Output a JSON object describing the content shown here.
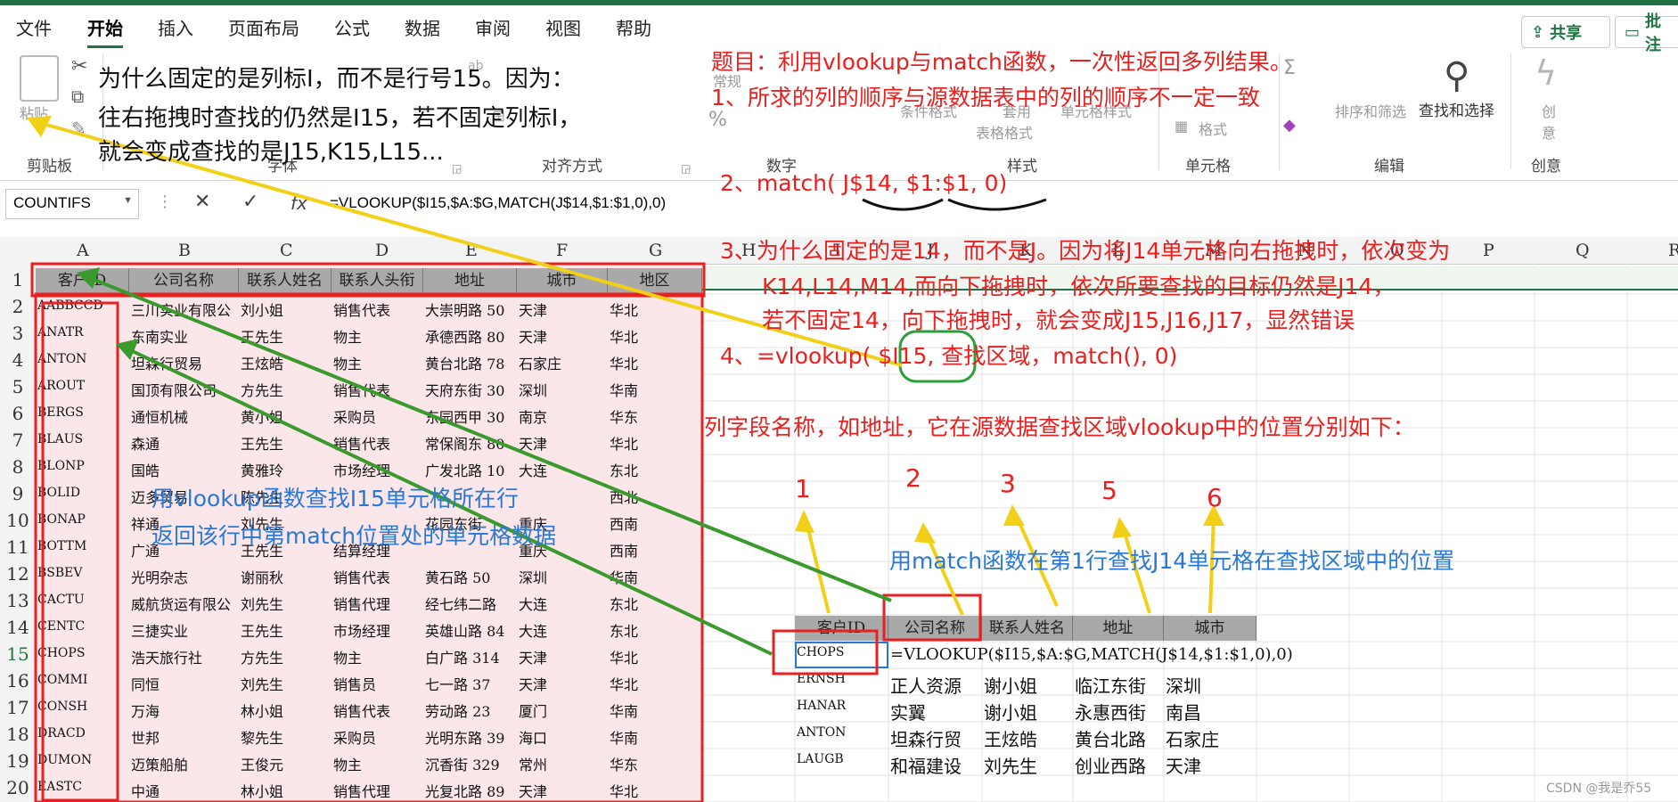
{
  "tabs": [
    "文件",
    "开始",
    "插入",
    "页面布局",
    "公式",
    "数据",
    "审阅",
    "视图",
    "帮助"
  ],
  "active_tab": "开始",
  "share_button": "共享",
  "comment_button": "批注",
  "ribbon": {
    "paste": "粘贴",
    "groups": [
      "剪贴板",
      "字体",
      "对齐方式",
      "数字",
      "样式",
      "单元格",
      "编辑",
      "创意"
    ],
    "number_format": "常规",
    "conditional": "条件格式",
    "table_format_1": "套用",
    "table_format_2": "表格格式",
    "cell_style": "单元格样式",
    "format": "格式",
    "sort": "排序和筛选",
    "find": "查找和选择",
    "creative_1": "创",
    "creative_2": "意"
  },
  "name_box": "COUNTIFS",
  "fx": "fx",
  "formula": "=VLOOKUP($I15,$A:$G,MATCH(J$14,$1:$1,0),0)",
  "columns": [
    "A",
    "B",
    "C",
    "D",
    "E",
    "F",
    "G",
    "H",
    "I",
    "J",
    "K",
    "L",
    "M",
    "N",
    "O",
    "P",
    "Q",
    "R"
  ],
  "rows": [
    "1",
    "2",
    "3",
    "4",
    "5",
    "6",
    "7",
    "8",
    "9",
    "10",
    "11",
    "12",
    "13",
    "14",
    "15",
    "16",
    "17",
    "18",
    "19",
    "20"
  ],
  "source_header": [
    "客户ID",
    "公司名称",
    "联系人姓名",
    "联系人头衔",
    "地址",
    "城市",
    "地区"
  ],
  "source_rows": [
    [
      "AABBCCD",
      "三川实业有限公",
      "刘小姐",
      "销售代表",
      "大崇明路 50",
      "天津",
      "华北"
    ],
    [
      "ANATR",
      "东南实业",
      "王先生",
      "物主",
      "承德西路 80",
      "天津",
      "华北"
    ],
    [
      "ANTON",
      "坦森行贸易",
      "王炫皓",
      "物主",
      "黄台北路 78",
      "石家庄",
      "华北"
    ],
    [
      "AROUT",
      "国顶有限公司",
      "方先生",
      "销售代表",
      "天府东街 30",
      "深圳",
      "华南"
    ],
    [
      "BERGS",
      "通恒机械",
      "黄小姐",
      "采购员",
      "东园西甲 30",
      "南京",
      "华东"
    ],
    [
      "BLAUS",
      "森通",
      "王先生",
      "销售代表",
      "常保阁东 80",
      "天津",
      "华北"
    ],
    [
      "BLONP",
      "国皓",
      "黄雅玲",
      "市场经理",
      "广发北路 10",
      "大连",
      "东北"
    ],
    [
      "BOLID",
      "迈多贸易",
      "陈先生",
      "",
      "",
      "",
      "西北"
    ],
    [
      "BONAP",
      "祥通",
      "刘先生",
      "",
      "花园东街",
      "重庆",
      "西南"
    ],
    [
      "BOTTM",
      "广通",
      "王先生",
      "结算经理",
      "",
      "重庆",
      "西南"
    ],
    [
      "BSBEV",
      "光明杂志",
      "谢丽秋",
      "销售代表",
      "黄石路 50",
      "深圳",
      "华南"
    ],
    [
      "CACTU",
      "威航货运有限公",
      "刘先生",
      "销售代理",
      "经七纬二路",
      "大连",
      "东北"
    ],
    [
      "CENTC",
      "三捷实业",
      "王先生",
      "市场经理",
      "英雄山路 84",
      "大连",
      "东北"
    ],
    [
      "CHOPS",
      "浩天旅行社",
      "方先生",
      "物主",
      "白广路 314",
      "天津",
      "华北"
    ],
    [
      "COMMI",
      "同恒",
      "刘先生",
      "销售员",
      "七一路 37",
      "天津",
      "华北"
    ],
    [
      "CONSH",
      "万海",
      "林小姐",
      "销售代表",
      "劳动路 23",
      "厦门",
      "华南"
    ],
    [
      "DRACD",
      "世邦",
      "黎先生",
      "采购员",
      "光明东路 39",
      "海口",
      "华南"
    ],
    [
      "DUMON",
      "迈策船舶",
      "王俊元",
      "物主",
      "沉香街 329",
      "常州",
      "华东"
    ],
    [
      "EASTC",
      "中通",
      "林小姐",
      "销售代理",
      "光复北路 89",
      "天津",
      "华北"
    ]
  ],
  "result_header": [
    "客户ID",
    "公司名称",
    "联系人姓名",
    "地址",
    "城市"
  ],
  "result_formula": "=VLOOKUP($I15,$A:$G,MATCH(J$14,$1:$1,0),0)",
  "result_rows": [
    [
      "CHOPS",
      "",
      "",
      "",
      ""
    ],
    [
      "ERNSH",
      "正人资源",
      "谢小姐",
      "临江东街",
      "深圳"
    ],
    [
      "HANAR",
      "实翼",
      "谢小姐",
      "永惠西街",
      "南昌"
    ],
    [
      "ANTON",
      "坦森行贸",
      "王炫皓",
      "黄台北路",
      "石家庄"
    ],
    [
      "LAUGB",
      "和福建设",
      "刘先生",
      "创业西路",
      "天津"
    ]
  ],
  "annotations": {
    "black_1": "为什么固定的是列标I，而不是行号15。因为：",
    "black_2": "往右拖拽时查找的仍然是I15，若不固定列标I，",
    "black_3": "就会变成查找的是J15,K15,L15...",
    "red_title": "题目：利用vlookup与match函数，一次性返回多列结果。",
    "red_1": "1、所求的列的顺序与源数据表中的列的顺序不一定一致",
    "red_2": "2、match(  J$14,  $1:$1,  0)",
    "red_3a": "3、为什么固定的是14，而不是J。因为将J14单元格向右拖拽时，依次变为",
    "red_3b": "K14,L14,M14,而向下拖拽时，依次所要查找的目标仍然是J14，",
    "red_3c": "若不固定14，向下拖拽时，就会变成J15,J16,J17，显然错误",
    "red_4": "4、=vlookup(  $I15,  查找区域，match(), 0)",
    "red_list": "列字段名称，如地址，它在源数据查找区域vlookup中的位置分别如下：",
    "blue_1": "用vlookup函数查找I15单元格所在行",
    "blue_2": "返回该行中第match位置处的单元格数据",
    "blue_match": "用match函数在第1行查找J14单元格在查找区域中的位置",
    "nums": [
      "1",
      "2",
      "3",
      "5",
      "6"
    ]
  },
  "watermark": "CSDN @我是乔55"
}
